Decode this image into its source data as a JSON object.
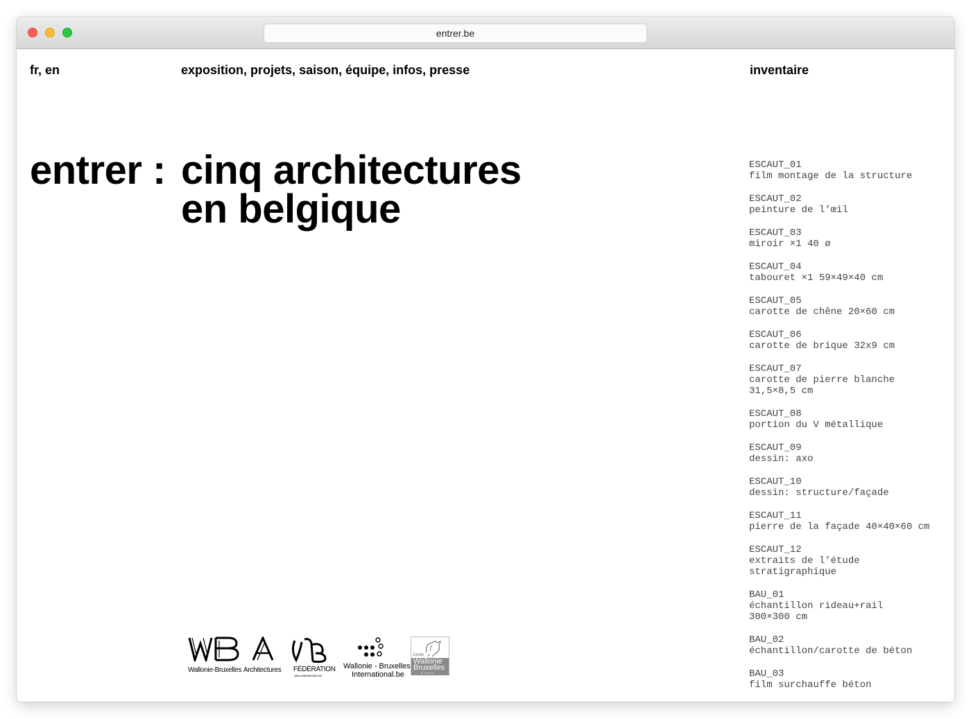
{
  "browser": {
    "url": "entrer.be"
  },
  "nav": {
    "languages": [
      {
        "label": "fr"
      },
      {
        "label": "en"
      }
    ],
    "menu": [
      {
        "label": "exposition"
      },
      {
        "label": "projets"
      },
      {
        "label": "saison"
      },
      {
        "label": "équipe"
      },
      {
        "label": "infos"
      },
      {
        "label": "presse"
      }
    ],
    "inventory_link": "inventaire"
  },
  "hero": {
    "prefix": "entrer :",
    "title_line1": "cinq architectures",
    "title_line2": "en belgique"
  },
  "inventory": [
    {
      "code": "ESCAUT_01",
      "lines": [
        "film montage de la structure"
      ]
    },
    {
      "code": "ESCAUT_02",
      "lines": [
        "peinture de l’œil"
      ]
    },
    {
      "code": "ESCAUT_03",
      "lines": [
        "miroir ×1 40 ø"
      ]
    },
    {
      "code": "ESCAUT_04",
      "lines": [
        "tabouret ×1 59×49×40 cm"
      ]
    },
    {
      "code": "ESCAUT_05",
      "lines": [
        "carotte de chêne 20×60 cm"
      ]
    },
    {
      "code": "ESCAUT_06",
      "lines": [
        "carotte de brique 32x9 cm"
      ]
    },
    {
      "code": "ESCAUT_07",
      "lines": [
        "carotte de pierre blanche",
        "31,5×8,5 cm"
      ]
    },
    {
      "code": "ESCAUT_08",
      "lines": [
        "portion du V métallique"
      ]
    },
    {
      "code": "ESCAUT_09",
      "lines": [
        "dessin: axo"
      ]
    },
    {
      "code": "ESCAUT_10",
      "lines": [
        "dessin: structure/façade"
      ]
    },
    {
      "code": "ESCAUT_11",
      "lines": [
        "pierre de la façade 40×40×60 cm"
      ]
    },
    {
      "code": "ESCAUT_12",
      "lines": [
        "extraits de l’étude",
        "stratigraphique"
      ]
    },
    {
      "code": "BAU_01",
      "lines": [
        "échantillon rideau+rail",
        "300×300 cm"
      ]
    },
    {
      "code": "BAU_02",
      "lines": [
        "échantillon/carotte de béton"
      ]
    },
    {
      "code": "BAU_03",
      "lines": [
        "film surchauffe béton"
      ]
    }
  ],
  "logos": {
    "wb_caption": "Wallonie-Bruxelles",
    "archi_caption": "Architectures",
    "fwb_caption": "FÉDÉRATION",
    "fwb_sub": "WALLONIE-BRUXELLES",
    "wbi_caption_1": "Wallonie - Bruxelles",
    "wbi_caption_2": "International.be",
    "centre_label": "Centre",
    "centre_line1": "Wallonie",
    "centre_line2": "Bruxelles",
    "centre_line3": "à Paris"
  }
}
